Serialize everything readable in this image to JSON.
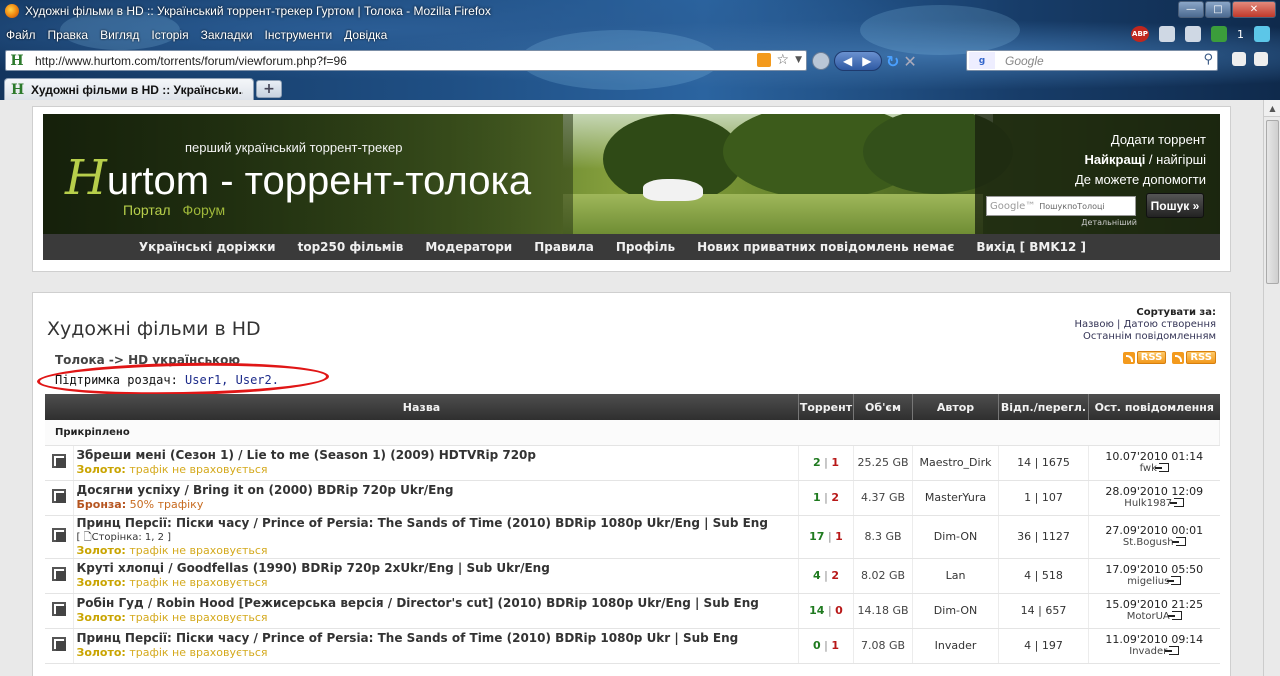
{
  "browser": {
    "window_title": "Художні фільми в HD :: Український торрент-трекер Гуртом | Толока - Mozilla Firefox",
    "menu": [
      "Файл",
      "Правка",
      "Вигляд",
      "Історія",
      "Закладки",
      "Інструменти",
      "Довідка"
    ],
    "abp_label": "ABP",
    "counter": "1",
    "url": "http://www.hurtom.com/torrents/forum/viewforum.php?f=96",
    "search_placeholder": "Google",
    "tab_title": "Художні фільми в HD :: Українськи...",
    "new_tab": "+",
    "favicon_letter": "H",
    "google_badge": "g"
  },
  "header": {
    "tagline": "перший український торрент-трекер",
    "logo_h": "H",
    "logo_rest": "urtom - торрент-толока",
    "portal": "Портал",
    "forum": "Форум",
    "add_torrent": "Додати торрент",
    "best_bold": "Найкращі",
    "best_rest": " / найгірші",
    "help": "Де можете допомогти",
    "gsearch_logo": "Google™",
    "gsearch_placeholder": "ПошукпоТолоці",
    "gsearch_button": "Пошук »",
    "gsearch_details": "Детальніший"
  },
  "navbar": [
    "Українські доріжки",
    "top250 фільмів",
    "Модератори",
    "Правила",
    "Профіль",
    "Нових приватних повідомлень немає",
    "Вихід [ BMK12 ]"
  ],
  "forum": {
    "title": "Художні фільми в HD",
    "breadcrumb": "Толока -> HD українською",
    "sort_label": "Сортувати за:",
    "sort_line1": "Назвою | Датою створення",
    "sort_line2": "Останнім повідомленням",
    "rss": "RSS",
    "support_label": "Підтримка роздач: ",
    "support_users": "User1, User2."
  },
  "table": {
    "headers": [
      "Назва",
      "Торрент",
      "Об'єм",
      "Автор",
      "Відп./перегл.",
      "Ост. повідомлення"
    ],
    "pinned": "Прикріплено",
    "rows": [
      {
        "title": "Збреши мені (Сезон 1) / Lie to me (Season 1) (2009) HDTVRip 720p",
        "status": "Золото:",
        "status_note": " трафік не враховується",
        "pages": "",
        "seed": "2",
        "leech": "1",
        "size": "25.25 GB",
        "author": "Maestro_Dirk",
        "replies": "14 | 1675",
        "last_date": "10.07'2010 01:14",
        "last_user": "fwk"
      },
      {
        "title": "Досягни успіху / Bring it on (2000) BDRip 720p Ukr/Eng",
        "status": "Бронза:",
        "status_note": " 50% трафіку",
        "pages": "",
        "seed": "1",
        "leech": "2",
        "size": "4.37 GB",
        "author": "MasterYura",
        "replies": "1 | 107",
        "last_date": "28.09'2010 12:09",
        "last_user": "Hulk1987"
      },
      {
        "title": "Принц Персії: Піски часу / Prince of Persia: The Sands of Time (2010) BDRip 1080p Ukr/Eng | Sub Eng",
        "status": "Золото:",
        "status_note": " трафік не враховується",
        "pages": "[ 🗋Сторінка: 1, 2 ]",
        "seed": "17",
        "leech": "1",
        "size": "8.3 GB",
        "author": "Dim-ON",
        "replies": "36 | 1127",
        "last_date": "27.09'2010 00:01",
        "last_user": "St.Bogush"
      },
      {
        "title": "Круті хлопці / Goodfellas (1990) BDRip 720p 2xUkr/Eng | Sub Ukr/Eng",
        "status": "Золото:",
        "status_note": " трафік не враховується",
        "pages": "",
        "seed": "4",
        "leech": "2",
        "size": "8.02 GB",
        "author": "Lan",
        "replies": "4 | 518",
        "last_date": "17.09'2010 05:50",
        "last_user": "migelius"
      },
      {
        "title": "Робін Гуд / Robin Hood [Режисерська версія / Director's cut] (2010) BDRip 1080p Ukr/Eng | Sub Eng",
        "status": "Золото:",
        "status_note": " трафік не враховується",
        "pages": "",
        "seed": "14",
        "leech": "0",
        "size": "14.18 GB",
        "author": "Dim-ON",
        "replies": "14 | 657",
        "last_date": "15.09'2010 21:25",
        "last_user": "MotorUA"
      },
      {
        "title": "Принц Персії: Піски часу / Prince of Persia: The Sands of Time (2010) BDRip 1080p Ukr | Sub Eng",
        "status": "Золото:",
        "status_note": " трафік не враховується",
        "pages": "",
        "seed": "0",
        "leech": "1",
        "size": "7.08 GB",
        "author": "Invader",
        "replies": "4 | 197",
        "last_date": "11.09'2010 09:14",
        "last_user": "Invader"
      }
    ]
  }
}
